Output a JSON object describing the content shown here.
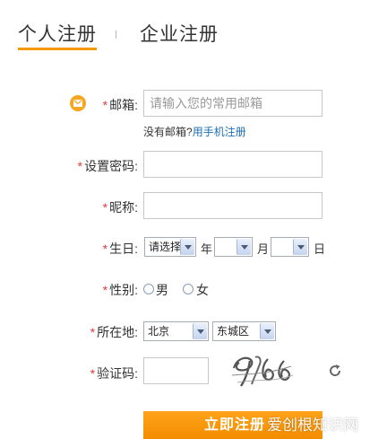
{
  "tabs": {
    "personal": "个人注册",
    "company": "企业注册"
  },
  "form": {
    "star": "*",
    "email": {
      "label": "邮箱:",
      "placeholder": "请输入您的常用邮箱",
      "hint_prefix": "没有邮箱?",
      "hint_link": "用手机注册"
    },
    "password": {
      "label": "设置密码:"
    },
    "nickname": {
      "label": "昵称:"
    },
    "birthday": {
      "label": "生日:",
      "year_select": "请选择",
      "year_unit": "年",
      "month_select": "",
      "month_unit": "月",
      "day_select": "",
      "day_unit": "日"
    },
    "gender": {
      "label": "性别:",
      "male": "男",
      "female": "女"
    },
    "location": {
      "label": "所在地:",
      "province": "北京",
      "district": "东城区"
    },
    "captcha": {
      "label": "验证码:",
      "image_text": "9166"
    },
    "submit": "立即注册"
  },
  "watermark": "爱创根知识网",
  "colors": {
    "accent": "#f39800",
    "required": "#e4393c",
    "link": "#1a6fb5"
  },
  "icons": {
    "email": "envelope-icon",
    "refresh": "refresh-icon"
  }
}
